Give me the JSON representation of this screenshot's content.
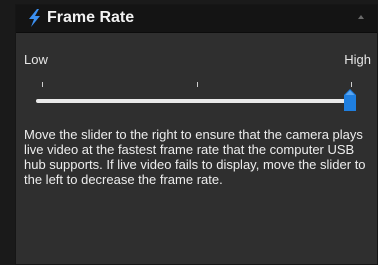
{
  "panel": {
    "title": "Frame Rate",
    "header_icon": "lightning-bolt-icon",
    "collapse_icon": "chevron-up-icon"
  },
  "slider": {
    "low_label": "Low",
    "high_label": "High",
    "value_fraction": 1.0,
    "tick_count": 3,
    "thumb_color": "#1f7fe0",
    "track_color": "#e9e9e9"
  },
  "description": "Move the slider to the right to ensure that the camera plays live video at the fastest frame rate that the computer USB hub supports. If live video fails to display, move the slider to the left to decrease the frame rate.",
  "colors": {
    "accent": "#1f7fe0",
    "bolt": "#3b8ff0"
  }
}
